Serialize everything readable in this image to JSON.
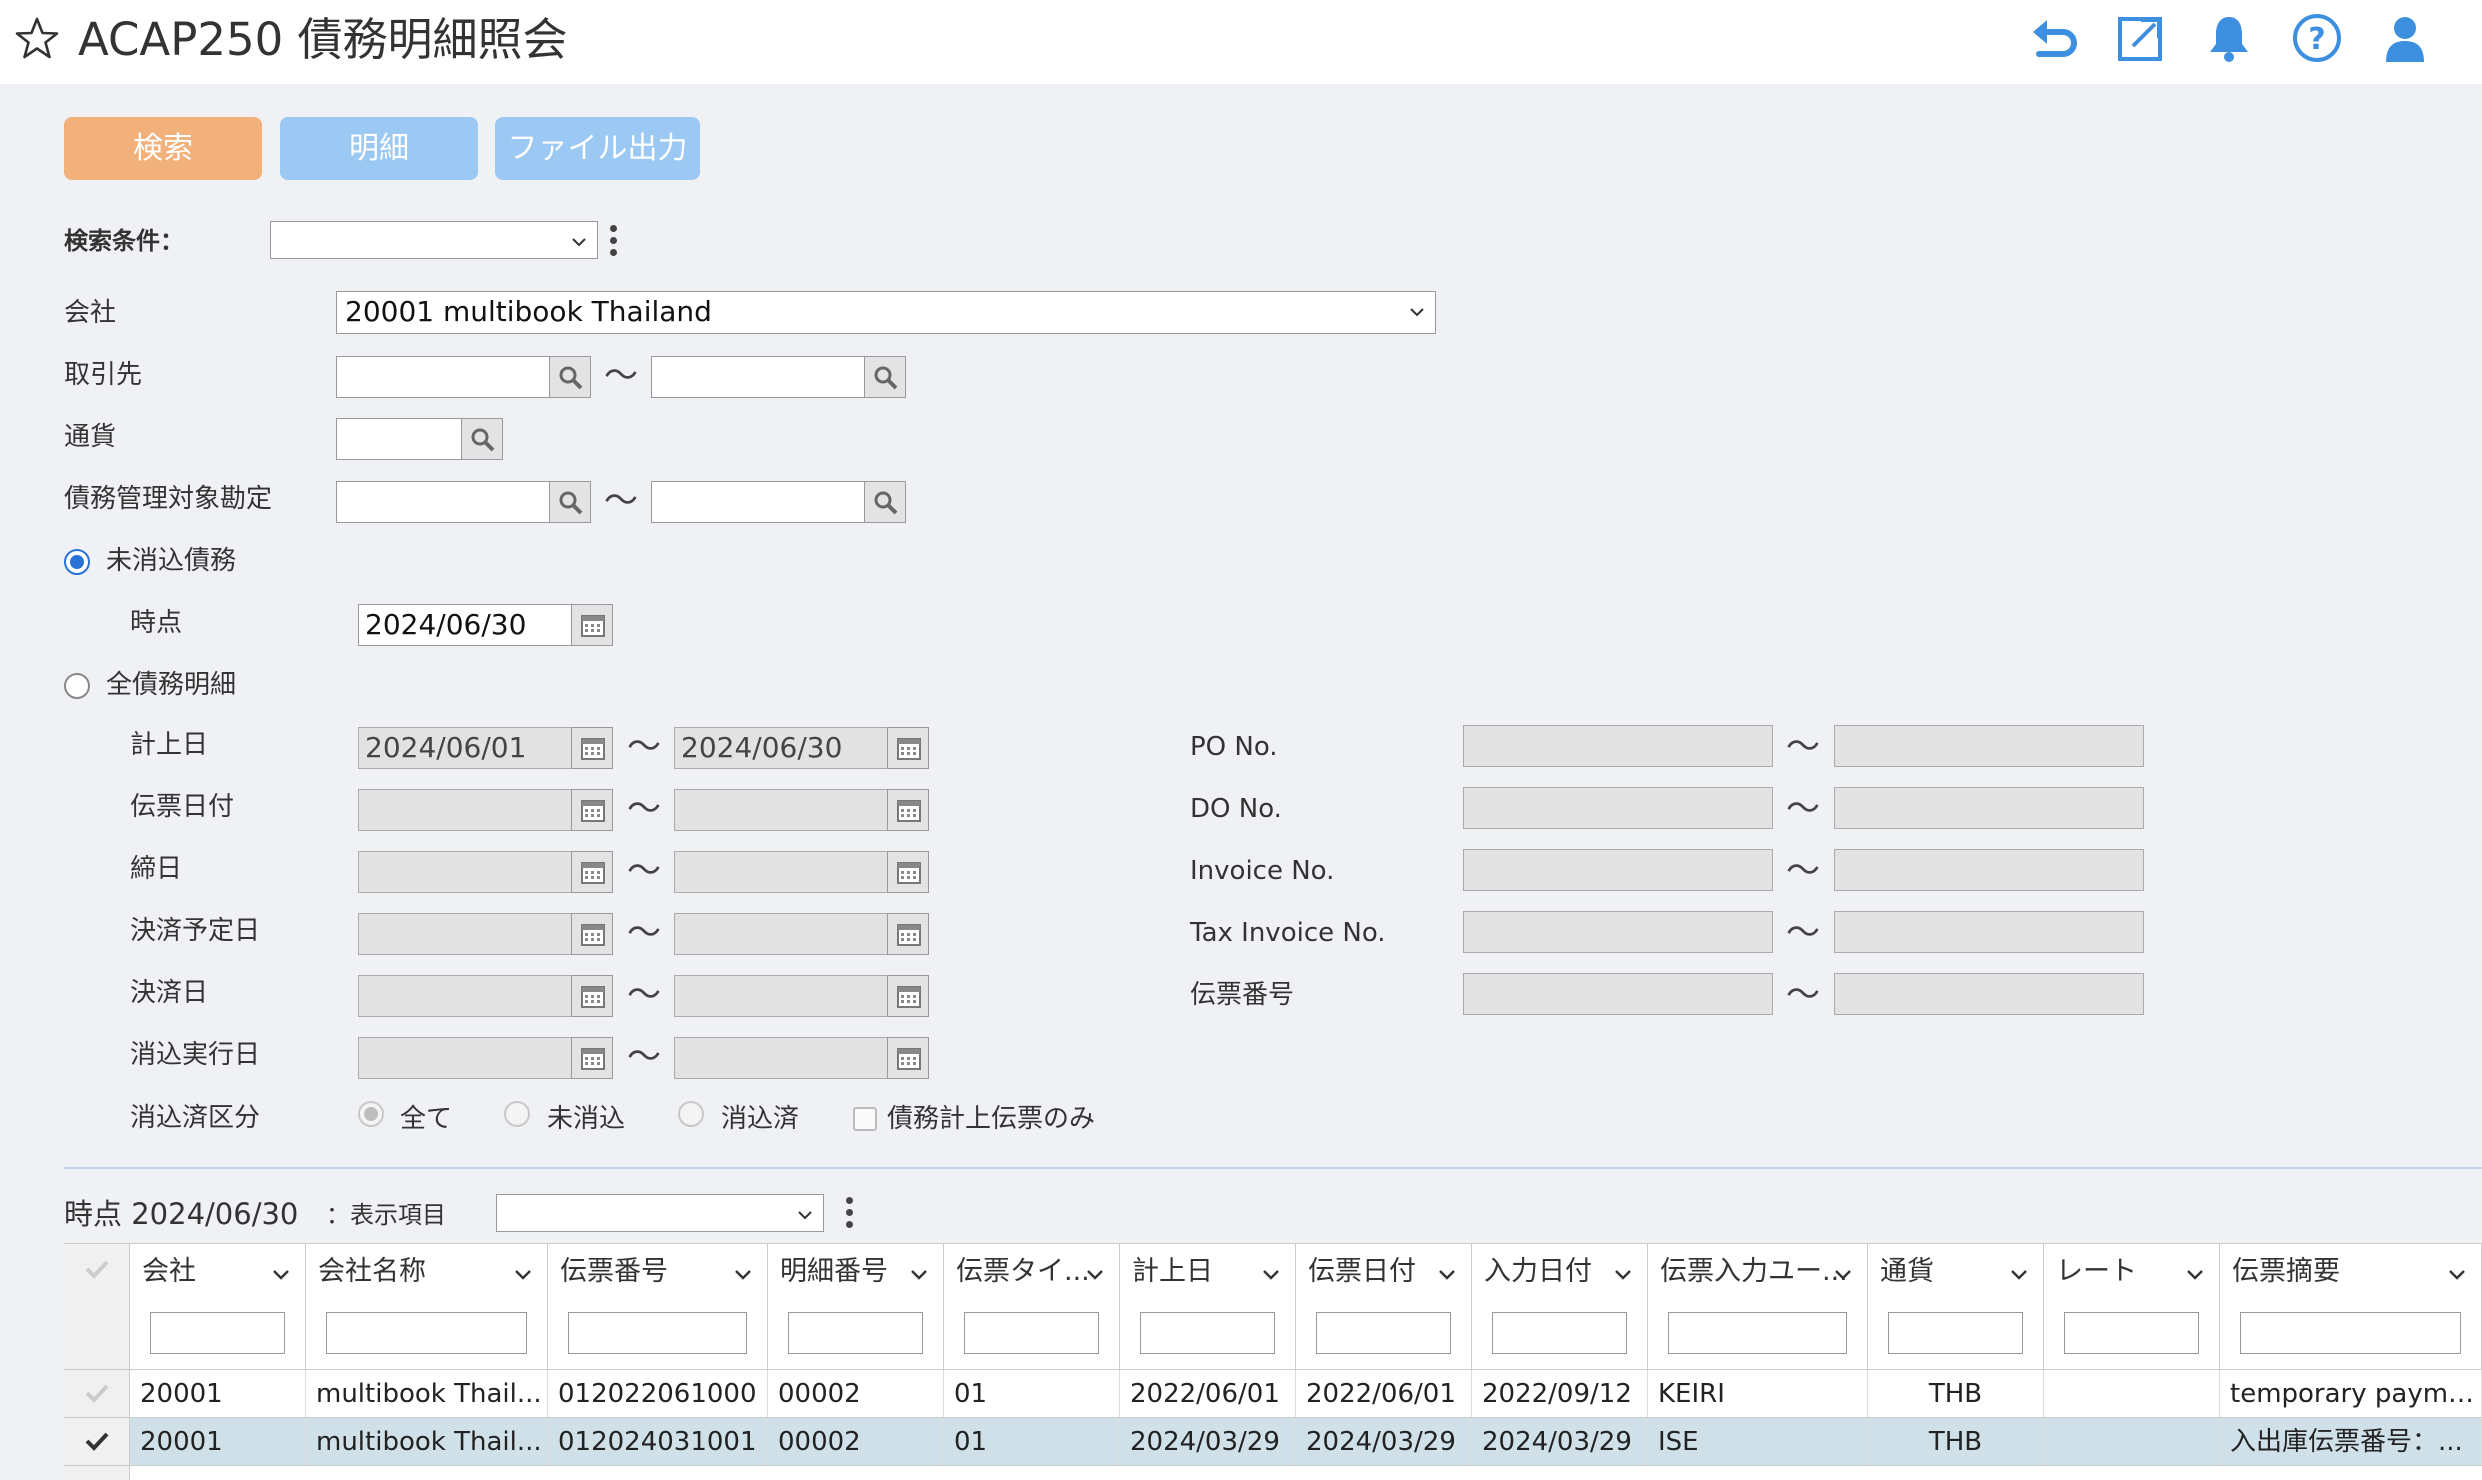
{
  "header": {
    "title": "ACAP250 債務明細照会",
    "icons": [
      "star-icon",
      "back-icon",
      "open-new-window-icon",
      "bell-icon",
      "help-icon",
      "user-icon"
    ]
  },
  "toolbar": {
    "search": "検索",
    "detail": "明細",
    "file_output": "ファイル出力"
  },
  "search_conditions": {
    "label": "検索条件：",
    "value": ""
  },
  "company": {
    "label": "会社",
    "value": "20001 multibook Thailand"
  },
  "partner": {
    "label": "取引先",
    "from": "",
    "to": ""
  },
  "currency": {
    "label": "通貨",
    "value": ""
  },
  "account": {
    "label": "債務管理対象勘定",
    "from": "",
    "to": ""
  },
  "mode_uncleared": {
    "label": "未消込債務",
    "selected": true
  },
  "as_of": {
    "label": "時点",
    "value": "2024/06/30"
  },
  "mode_all": {
    "label": "全債務明細",
    "selected": false
  },
  "tilde": "〜",
  "date_ranges": [
    {
      "label": "計上日",
      "from": "2024/06/01",
      "to": "2024/06/30"
    },
    {
      "label": "伝票日付",
      "from": "",
      "to": ""
    },
    {
      "label": "締日",
      "from": "",
      "to": ""
    },
    {
      "label": "決済予定日",
      "from": "",
      "to": ""
    },
    {
      "label": "決済日",
      "from": "",
      "to": ""
    },
    {
      "label": "消込実行日",
      "from": "",
      "to": ""
    }
  ],
  "number_ranges": [
    {
      "label": "PO No.",
      "from": "",
      "to": ""
    },
    {
      "label": "DO No.",
      "from": "",
      "to": ""
    },
    {
      "label": "Invoice No.",
      "from": "",
      "to": ""
    },
    {
      "label": "Tax Invoice No.",
      "from": "",
      "to": ""
    },
    {
      "label": "伝票番号",
      "from": "",
      "to": ""
    }
  ],
  "clear_status": {
    "label": "消込済区分",
    "options": [
      "全て",
      "未消込",
      "消込済"
    ],
    "selected": "全て",
    "checkbox_label": "債務計上伝票のみ"
  },
  "result": {
    "as_of_label": "時点 2024/06/30",
    "display_items_label": "：表示項目",
    "display_items_value": ""
  },
  "table": {
    "columns": [
      "会社",
      "会社名称",
      "伝票番号",
      "明細番号",
      "伝票タイ...",
      "計上日",
      "伝票日付",
      "入力日付",
      "伝票入力ユー...",
      "通貨",
      "レート",
      "伝票摘要"
    ],
    "rows": [
      {
        "selected": false,
        "cells": [
          "20001",
          "multibook Thail...",
          "012022061000",
          "00002",
          "01",
          "2022/06/01",
          "2022/06/01",
          "2022/09/12",
          "KEIRI",
          "THB",
          "",
          "temporary payment"
        ]
      },
      {
        "selected": true,
        "cells": [
          "20001",
          "multibook Thail...",
          "012024031001",
          "00002",
          "01",
          "2024/03/29",
          "2024/03/29",
          "2024/03/29",
          "ISE",
          "THB",
          "",
          "入出庫伝票番号：..."
        ]
      }
    ]
  },
  "colors": {
    "search_button": "#f2b07a",
    "secondary_button": "#9cc8f4",
    "icon_blue": "#3d8fe0",
    "selected_row": "#cfe0e8"
  }
}
